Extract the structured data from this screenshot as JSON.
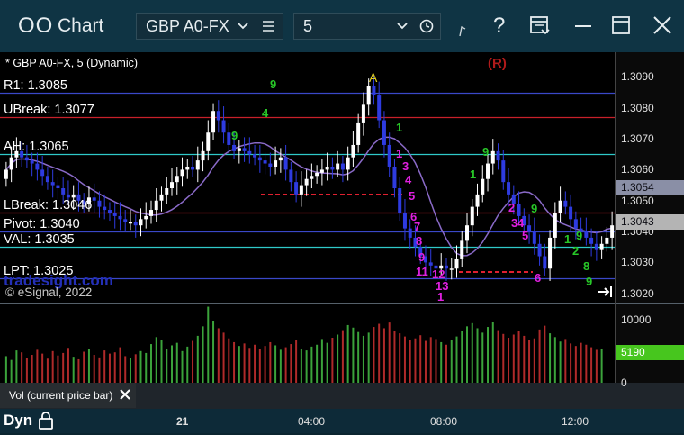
{
  "window": {
    "title": "Chart",
    "logo_glyph": "OO"
  },
  "toolbar": {
    "symbol": "GBP A0-FX",
    "interval": "5",
    "icons": [
      "chevron-down-icon",
      "list-icon",
      "chevron-down-icon",
      "clock-icon",
      "cursor-icon",
      "help-icon",
      "layout-icon",
      "minimize-icon",
      "maximize-icon",
      "close-icon"
    ]
  },
  "chart": {
    "header": "* GBP A0-FX, 5 (Dynamic)",
    "wave_label": "A",
    "r_marker": "(R)",
    "watermark": "tradesight.com",
    "copyright": "© eSignal, 2022",
    "levels": [
      {
        "name": "R1",
        "text": "R1: 1.3085",
        "value": 1.3085,
        "color": "#3a48c8"
      },
      {
        "name": "UBreak",
        "text": "UBreak: 1.3077",
        "value": 1.3077,
        "color": "#c8202a"
      },
      {
        "name": "AH",
        "text": "AH: 1.3065",
        "value": 1.3065,
        "color": "#2fc9c9"
      },
      {
        "name": "LBreak",
        "text": "LBreak: 1.3046",
        "value": 1.3046,
        "color": "#c8202a"
      },
      {
        "name": "Pivot",
        "text": "Pivot: 1.3040",
        "value": 1.304,
        "color": "#3a48c8"
      },
      {
        "name": "VAL",
        "text": "VAL: 1.3035",
        "value": 1.3035,
        "color": "#2fc9c9"
      },
      {
        "name": "LPT",
        "text": "LPT: 1.3025",
        "value": 1.3025,
        "color": "#3a48c8"
      }
    ],
    "price_axis": [
      "1.3090",
      "1.3080",
      "1.3070",
      "1.3060",
      "1.3050",
      "1.3040",
      "1.3030",
      "1.3020"
    ],
    "price_tags": [
      {
        "text": "1.3054",
        "value": 1.3054,
        "bg": "#8a8fa6",
        "fg": "#0b0b12"
      },
      {
        "text": "1.3043",
        "value": 1.3043,
        "bg": "#b4b4b4",
        "fg": "#0b0b12"
      }
    ],
    "time_axis": [
      "21",
      "04:00",
      "08:00",
      "12:00"
    ],
    "counts_magenta": [
      "1",
      "3",
      "4",
      "5",
      "6",
      "7",
      "8",
      "9",
      "11",
      "12",
      "13",
      "1",
      "2",
      "3",
      "4",
      "5",
      "6"
    ],
    "counts_green": [
      "9",
      "4",
      "9",
      "1",
      "9",
      "1",
      "9",
      "9",
      "1",
      "2",
      "8",
      "9"
    ]
  },
  "volume": {
    "axis": [
      "10000",
      "5000",
      "0"
    ],
    "tag": "5190",
    "tab_label": "Vol (current price bar)"
  },
  "status": {
    "mode": "Dyn"
  },
  "chart_data": {
    "type": "candlestick",
    "title": "GBP A0-FX, 5 (Dynamic)",
    "ylim": [
      1.3017,
      1.3098
    ],
    "x_ticks": [
      "21",
      "04:00",
      "08:00",
      "12:00"
    ],
    "close_series": [
      1.306,
      1.3064,
      1.3066,
      1.3064,
      1.3063,
      1.3062,
      1.306,
      1.3058,
      1.3056,
      1.3055,
      1.3054,
      1.3052,
      1.3051,
      1.3052,
      1.305,
      1.3049,
      1.3051,
      1.305,
      1.3048,
      1.3047,
      1.3046,
      1.3045,
      1.3044,
      1.3043,
      1.3043,
      1.3042,
      1.3044,
      1.3045,
      1.3047,
      1.305,
      1.3052,
      1.3054,
      1.3056,
      1.3058,
      1.306,
      1.3061,
      1.306,
      1.3063,
      1.3066,
      1.3072,
      1.3079,
      1.3076,
      1.3072,
      1.3068,
      1.3066,
      1.3067,
      1.3066,
      1.3065,
      1.3064,
      1.3063,
      1.3062,
      1.3061,
      1.3063,
      1.3064,
      1.306,
      1.3056,
      1.3052,
      1.3055,
      1.3057,
      1.3058,
      1.3059,
      1.306,
      1.3061,
      1.306,
      1.3062,
      1.306,
      1.3064,
      1.3068,
      1.3075,
      1.3081,
      1.3087,
      1.3084,
      1.3076,
      1.3068,
      1.3061,
      1.3054,
      1.3046,
      1.3041,
      1.3038,
      1.3035,
      1.3032,
      1.303,
      1.3029,
      1.3028,
      1.3029,
      1.3028,
      1.3028,
      1.3031,
      1.3037,
      1.3042,
      1.3048,
      1.3052,
      1.3057,
      1.3062,
      1.3066,
      1.3063,
      1.3056,
      1.3052,
      1.3049,
      1.3045,
      1.3042,
      1.304,
      1.3036,
      1.3032,
      1.3028,
      1.3038,
      1.3046,
      1.305,
      1.3048,
      1.3044,
      1.3041,
      1.304,
      1.3038,
      1.3036,
      1.3034,
      1.3036,
      1.3038,
      1.3042
    ],
    "series": [
      {
        "name": "volume",
        "values": [
          4200,
          3600,
          5100,
          4800,
          3900,
          4400,
          5200,
          4600,
          3800,
          5000,
          4300,
          4700,
          5500,
          4100,
          3700,
          4900,
          5300,
          4400,
          4000,
          5100,
          4600,
          4800,
          5600,
          4200,
          3900,
          4500,
          5000,
          4700,
          6100,
          7200,
          6800,
          5400,
          5900,
          6300,
          5000,
          5700,
          6600,
          7400,
          8900,
          12000,
          9800,
          8600,
          7900,
          7000,
          6400,
          5800,
          6200,
          5500,
          6000,
          5300,
          5800,
          6400,
          5900,
          5200,
          5600,
          6100,
          6700,
          5400,
          5100,
          5700,
          6000,
          6900,
          6300,
          7100,
          7600,
          8300,
          9100,
          8700,
          8000,
          7400,
          7900,
          8800,
          9300,
          8600,
          9500,
          8200,
          7800,
          7300,
          6800,
          7000,
          7500,
          6600,
          7200,
          6900,
          6400,
          6000,
          6700,
          7300,
          8100,
          8900,
          9400,
          8600,
          7900,
          8800,
          9600,
          8300,
          7700,
          7100,
          7600,
          8200,
          7400,
          6700,
          7000,
          8400,
          9000,
          7800,
          7200,
          6500,
          6900,
          6200,
          5800,
          6300,
          6000,
          5600,
          5190,
          5400
        ]
      }
    ]
  }
}
